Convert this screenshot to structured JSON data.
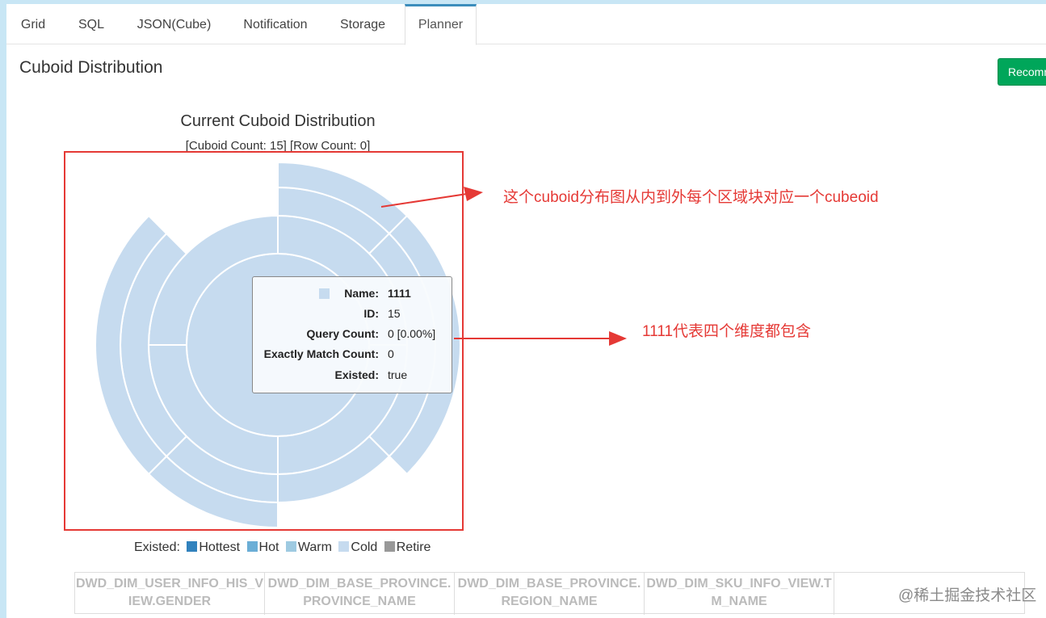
{
  "tabs": [
    {
      "label": "Grid",
      "active": false
    },
    {
      "label": "SQL",
      "active": false
    },
    {
      "label": "JSON(Cube)",
      "active": false
    },
    {
      "label": "Notification",
      "active": false
    },
    {
      "label": "Storage",
      "active": false
    },
    {
      "label": "Planner",
      "active": true
    }
  ],
  "section_title": "Cuboid Distribution",
  "recommend_button_label": "Recommend",
  "colors": {
    "accent": "#3c8dbc",
    "button_green": "#00a65a",
    "annotation_red": "#e53935",
    "segment_fill": "#c6dbef"
  },
  "chart_data": {
    "type": "sunburst",
    "title": "Current Cuboid Distribution",
    "subtitle": "[Cuboid Count: 15] [Row Count: 0]",
    "cuboid_count": 15,
    "row_count": 0,
    "legend_label": "Existed:",
    "legend": [
      {
        "label": "Hottest",
        "color": "#3182bd"
      },
      {
        "label": "Hot",
        "color": "#6baed6"
      },
      {
        "label": "Warm",
        "color": "#9ecae1"
      },
      {
        "label": "Cold",
        "color": "#c6dbef"
      },
      {
        "label": "Retire",
        "color": "#999999"
      }
    ]
  },
  "tooltip": {
    "rows": [
      {
        "key": "Name:",
        "value": "1111",
        "bold": true
      },
      {
        "key": "ID:",
        "value": "15"
      },
      {
        "key": "Query Count:",
        "value": "0 [0.00%]"
      },
      {
        "key": "Exactly Match Count:",
        "value": "0"
      },
      {
        "key": "Existed:",
        "value": "true"
      }
    ]
  },
  "annotations": {
    "top": "这个cuboid分布图从内到外每个区域块对应一个cubeoid",
    "middle": "1111代表四个维度都包含"
  },
  "dimension_columns": [
    "DWD_DIM_USER_INFO_HIS_VIEW.GENDER",
    "DWD_DIM_BASE_PROVINCE.PROVINCE_NAME",
    "DWD_DIM_BASE_PROVINCE.REGION_NAME",
    "DWD_DIM_SKU_INFO_VIEW.TM_NAME"
  ],
  "watermark": "@稀土掘金技术社区"
}
